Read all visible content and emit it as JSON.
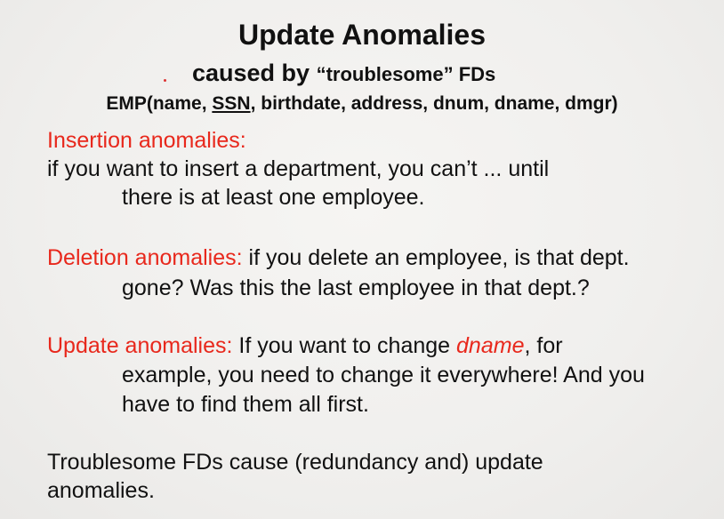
{
  "slide": {
    "title": "Update Anomalies",
    "subtitle_prefix": "caused by",
    "subtitle_quoted": "“troublesome” FDs",
    "schema": {
      "before": "EMP(name, ",
      "key": "SSN",
      "after": ", birthdate, address, dnum, dname, dmgr)"
    },
    "insertion": {
      "heading": "Insertion anomalies:",
      "line1": "if you want to insert a department, you can’t ... until",
      "line2": "there is at least one employee."
    },
    "deletion": {
      "heading": "Deletion anomalies:",
      "line1_rest": " if you delete an employee, is that dept.",
      "line2": "gone?  Was this the last employee in that dept.?"
    },
    "update": {
      "heading": "Update anomalies:",
      "line1_rest": " If you want to change ",
      "attr": "dname",
      "line1_end": ", for",
      "line2": "example, you need to change it everywhere!  And you",
      "line3": "have to find them all first."
    },
    "summary": {
      "line1": "Troublesome FDs cause (redundancy and) update",
      "line2": "anomalies."
    }
  }
}
